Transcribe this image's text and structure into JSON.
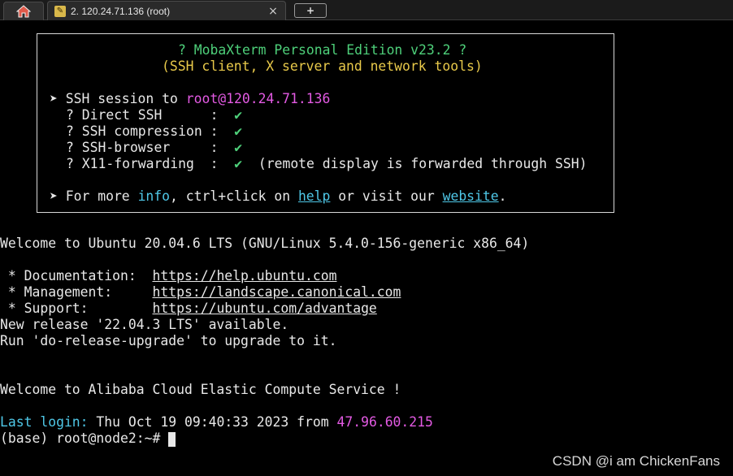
{
  "tabs": {
    "home_icon": "home-icon",
    "session_title": "2. 120.24.71.136 (root)",
    "session_icon": "key-icon",
    "close_glyph": "×",
    "new_tab_glyph": "+"
  },
  "banner": {
    "title": "? MobaXterm Personal Edition v23.2 ?",
    "subtitle": "(SSH client, X server and network tools)",
    "session_prefix": "➤ SSH session to ",
    "session_host": "root@120.24.71.136",
    "features": [
      {
        "label": "? Direct SSH      :  ",
        "check": "✔",
        "note": ""
      },
      {
        "label": "? SSH compression :  ",
        "check": "✔",
        "note": ""
      },
      {
        "label": "? SSH-browser     :  ",
        "check": "✔",
        "note": ""
      },
      {
        "label": "? X11-forwarding  :  ",
        "check": "✔",
        "note": "  (remote display is forwarded through SSH)"
      }
    ],
    "more_prefix": "➤ For more ",
    "info": "info",
    "more_mid": ", ctrl+click on ",
    "help": "help",
    "more_mid2": " or visit our ",
    "website": "website",
    "more_end": "."
  },
  "motd": {
    "welcome": "Welcome to Ubuntu 20.04.6 LTS (GNU/Linux 5.4.0-156-generic x86_64)",
    "links": [
      {
        "label": " * Documentation:  ",
        "url": "https://help.ubuntu.com"
      },
      {
        "label": " * Management:     ",
        "url": "https://landscape.canonical.com"
      },
      {
        "label": " * Support:        ",
        "url": "https://ubuntu.com/advantage"
      }
    ],
    "release_line": "New release '22.04.3 LTS' available.",
    "upgrade_line": "Run 'do-release-upgrade' to upgrade to it.",
    "alibaba": "Welcome to Alibaba Cloud Elastic Compute Service !"
  },
  "last_login": {
    "label": "Last login:",
    "text": " Thu Oct 19 09:40:33 2023 from ",
    "ip": "47.96.60.215"
  },
  "prompt": "(base) root@node2:~# ",
  "watermark": "CSDN @i am ChickenFans",
  "colors": {
    "background": "#000000",
    "green": "#4ed07a",
    "yellow": "#e8c94a",
    "magenta": "#e35ae3",
    "cyan": "#4fc8e8"
  }
}
